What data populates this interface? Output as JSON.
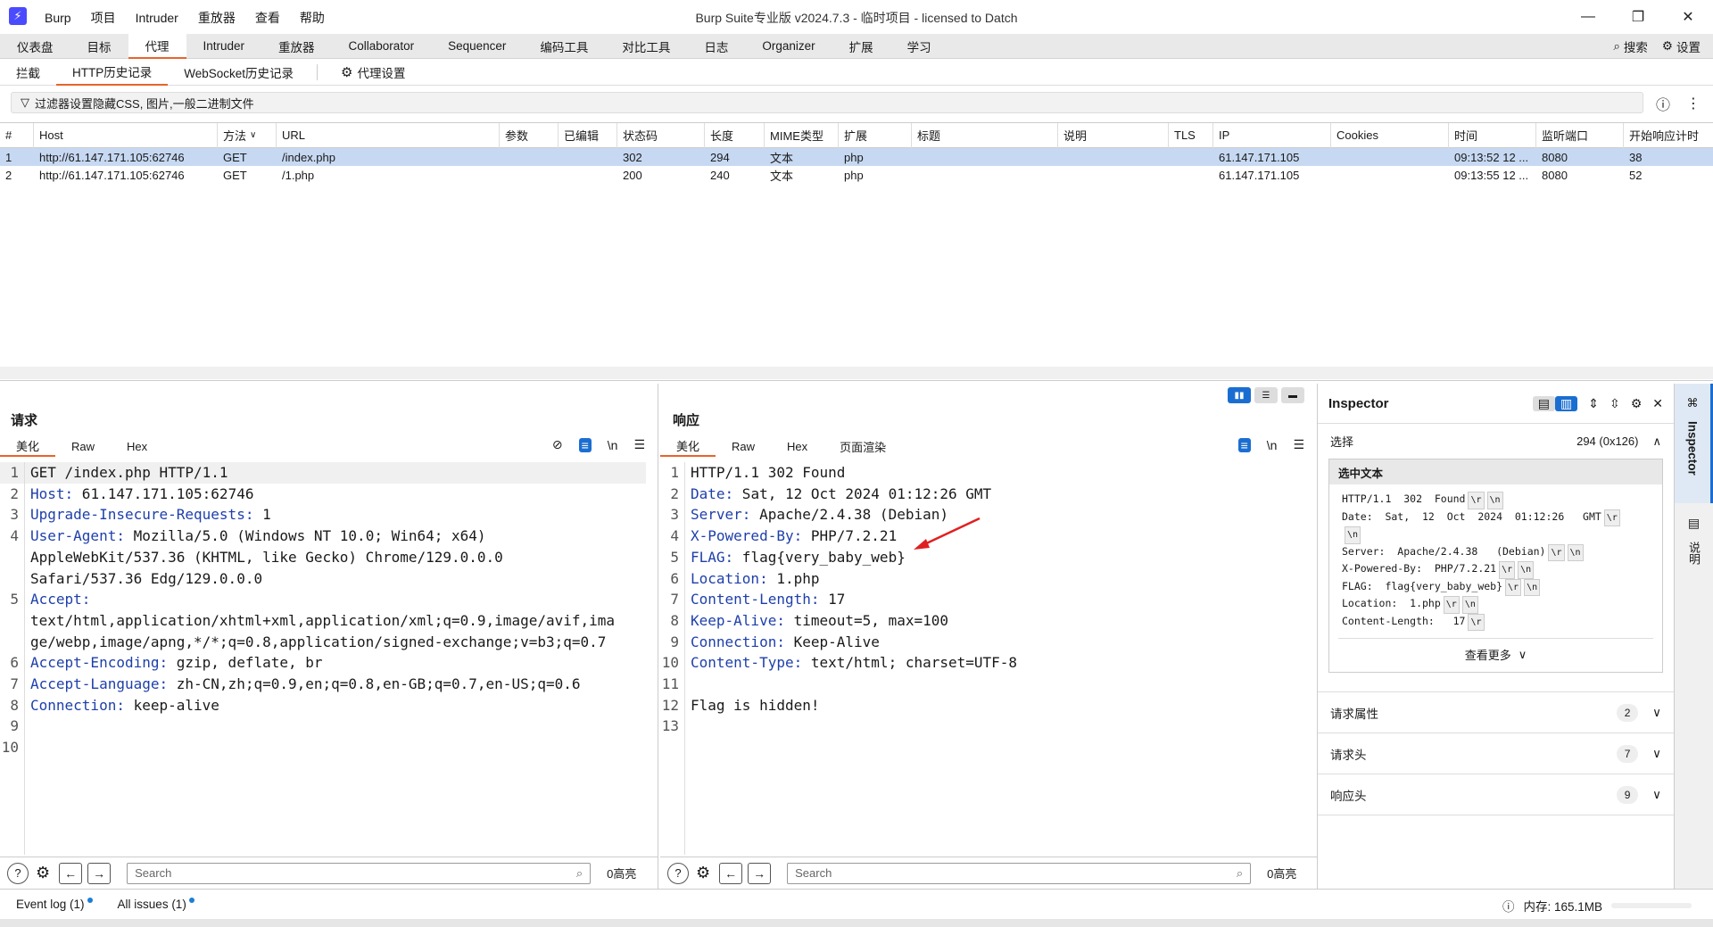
{
  "app": {
    "logo": "⚡",
    "title": "Burp Suite专业版  v2024.7.3 - 临时项目 - licensed to Datch",
    "menu": [
      "Burp",
      "项目",
      "Intruder",
      "重放器",
      "查看",
      "帮助"
    ],
    "window_controls": [
      "—",
      "❐",
      "✕"
    ]
  },
  "main_tabs": [
    "仪表盘",
    "目标",
    "代理",
    "Intruder",
    "重放器",
    "Collaborator",
    "Sequencer",
    "编码工具",
    "对比工具",
    "日志",
    "Organizer",
    "扩展",
    "学习"
  ],
  "main_tab_active": 2,
  "top_right": {
    "search": "搜索",
    "settings": "设置"
  },
  "sub_tabs": [
    "拦截",
    "HTTP历史记录",
    "WebSocket历史记录"
  ],
  "sub_tab_active": 1,
  "proxy_settings": "代理设置",
  "filter_text": "过滤器设置隐藏CSS, 图片,一般二进制文件",
  "history": {
    "columns": [
      "#",
      "Host",
      "方法",
      "URL",
      "参数",
      "已编辑",
      "状态码",
      "长度",
      "MIME类型",
      "扩展",
      "标题",
      "说明",
      "TLS",
      "IP",
      "Cookies",
      "时间",
      "监听端口",
      "开始响应计时"
    ],
    "rows": [
      [
        "1",
        "http://61.147.171.105:62746",
        "GET",
        "/index.php",
        "",
        "",
        "302",
        "294",
        "文本",
        "php",
        "",
        "",
        "",
        "61.147.171.105",
        "",
        "09:13:52 12 ...",
        "8080",
        "38"
      ],
      [
        "2",
        "http://61.147.171.105:62746",
        "GET",
        "/1.php",
        "",
        "",
        "200",
        "240",
        "文本",
        "php",
        "",
        "",
        "",
        "61.147.171.105",
        "",
        "09:13:55 12 ...",
        "8080",
        "52"
      ]
    ]
  },
  "request": {
    "title": "请求",
    "tabs": [
      "美化",
      "Raw",
      "Hex"
    ],
    "lines": [
      {
        "n": "1",
        "h": "",
        "v": "GET /index.php HTTP/1.1"
      },
      {
        "n": "2",
        "h": "Host:",
        "v": " 61.147.171.105:62746"
      },
      {
        "n": "3",
        "h": "Upgrade-Insecure-Requests:",
        "v": " 1"
      },
      {
        "n": "4",
        "h": "User-Agent:",
        "v": " Mozilla/5.0 (Windows NT 10.0; Win64; x64)"
      },
      {
        "n": "",
        "h": "",
        "v": "AppleWebKit/537.36 (KHTML, like Gecko) Chrome/129.0.0.0"
      },
      {
        "n": "",
        "h": "",
        "v": "Safari/537.36 Edg/129.0.0.0"
      },
      {
        "n": "5",
        "h": "Accept:",
        "v": ""
      },
      {
        "n": "",
        "h": "",
        "v": "text/html,application/xhtml+xml,application/xml;q=0.9,image/avif,ima"
      },
      {
        "n": "",
        "h": "",
        "v": "ge/webp,image/apng,*/*;q=0.8,application/signed-exchange;v=b3;q=0.7"
      },
      {
        "n": "6",
        "h": "Accept-Encoding:",
        "v": " gzip, deflate, br"
      },
      {
        "n": "7",
        "h": "Accept-Language:",
        "v": " zh-CN,zh;q=0.9,en;q=0.8,en-GB;q=0.7,en-US;q=0.6"
      },
      {
        "n": "8",
        "h": "Connection:",
        "v": " keep-alive"
      },
      {
        "n": "9",
        "h": "",
        "v": ""
      },
      {
        "n": "10",
        "h": "",
        "v": ""
      }
    ],
    "search_placeholder": "Search",
    "highlights": "0高亮"
  },
  "response": {
    "title": "响应",
    "tabs": [
      "美化",
      "Raw",
      "Hex",
      "页面渲染"
    ],
    "lines": [
      {
        "n": "1",
        "h": "",
        "v": "HTTP/1.1 302 Found"
      },
      {
        "n": "2",
        "h": "Date:",
        "v": " Sat, 12 Oct 2024 01:12:26 GMT"
      },
      {
        "n": "3",
        "h": "Server:",
        "v": " Apache/2.4.38 (Debian)"
      },
      {
        "n": "4",
        "h": "X-Powered-By:",
        "v": " PHP/7.2.21"
      },
      {
        "n": "5",
        "h": "FLAG:",
        "v": " flag{very_baby_web}"
      },
      {
        "n": "6",
        "h": "Location:",
        "v": " 1.php"
      },
      {
        "n": "7",
        "h": "Content-Length:",
        "v": " 17"
      },
      {
        "n": "8",
        "h": "Keep-Alive:",
        "v": " timeout=5, max=100"
      },
      {
        "n": "9",
        "h": "Connection:",
        "v": " Keep-Alive"
      },
      {
        "n": "10",
        "h": "Content-Type:",
        "v": " text/html; charset=UTF-8"
      },
      {
        "n": "11",
        "h": "",
        "v": ""
      },
      {
        "n": "12",
        "h": "",
        "v": "Flag is hidden!"
      },
      {
        "n": "13",
        "h": "",
        "v": ""
      }
    ],
    "search_placeholder": "Search",
    "highlights": "0高亮"
  },
  "inspector": {
    "title": "Inspector",
    "selection_label": "选择",
    "selection_value": "294 (0x126)",
    "selected_text_label": "选中文本",
    "selected_lines": [
      "HTTP/1.1  302  Found",
      "Date:  Sat,  12  Oct  2024  01:12:26   GMT",
      "",
      "Server:  Apache/2.4.38   (Debian)",
      "X-Powered-By:  PHP/7.2.21",
      "FLAG:  flag{very_baby_web}",
      "Location:  1.php",
      "Content-Length:   17"
    ],
    "crlf_r": "\\r",
    "crlf_n": "\\n",
    "see_more": "查看更多",
    "sections": [
      {
        "label": "请求属性",
        "count": "2"
      },
      {
        "label": "请求头",
        "count": "7"
      },
      {
        "label": "响应头",
        "count": "9"
      }
    ],
    "side_tab": "Inspector",
    "side_tab2": "说明"
  },
  "status": {
    "event_log": "Event log (1)",
    "all_issues": "All issues (1)",
    "memory": "内存: 165.1MB"
  },
  "colors": {
    "accent": "#e8632a",
    "header_key": "#1e3faa",
    "selected_row": "#c7d9f2",
    "arrow": "#e02020",
    "blue_btn": "#1b6ed1"
  }
}
